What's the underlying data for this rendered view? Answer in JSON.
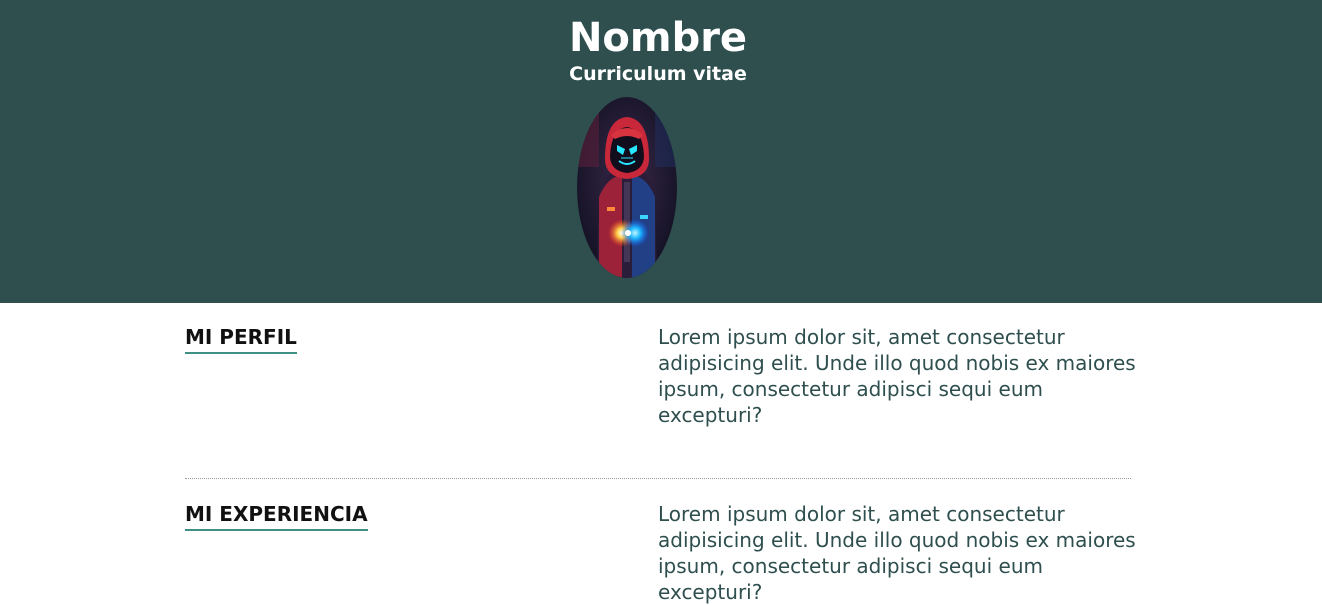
{
  "header": {
    "name": "Nombre",
    "subtitle": "Curriculum vitae",
    "background_color": "#2f4f4f",
    "avatar_icon": "hooded-figure-avatar"
  },
  "sections": [
    {
      "title": "MI PERFIL",
      "text": "Lorem ipsum dolor sit, amet consectetur adipisicing elit. Unde illo quod nobis ex maiores ipsum, consectetur adipisci sequi eum excepturi?"
    },
    {
      "title": "MI EXPERIENCIA",
      "text": "Lorem ipsum dolor sit, amet consectetur adipisicing elit. Unde illo quod nobis ex maiores ipsum, consectetur adipisci sequi eum excepturi?"
    }
  ],
  "colors": {
    "accent": "#3f8f85",
    "text": "#2f4f4f"
  }
}
